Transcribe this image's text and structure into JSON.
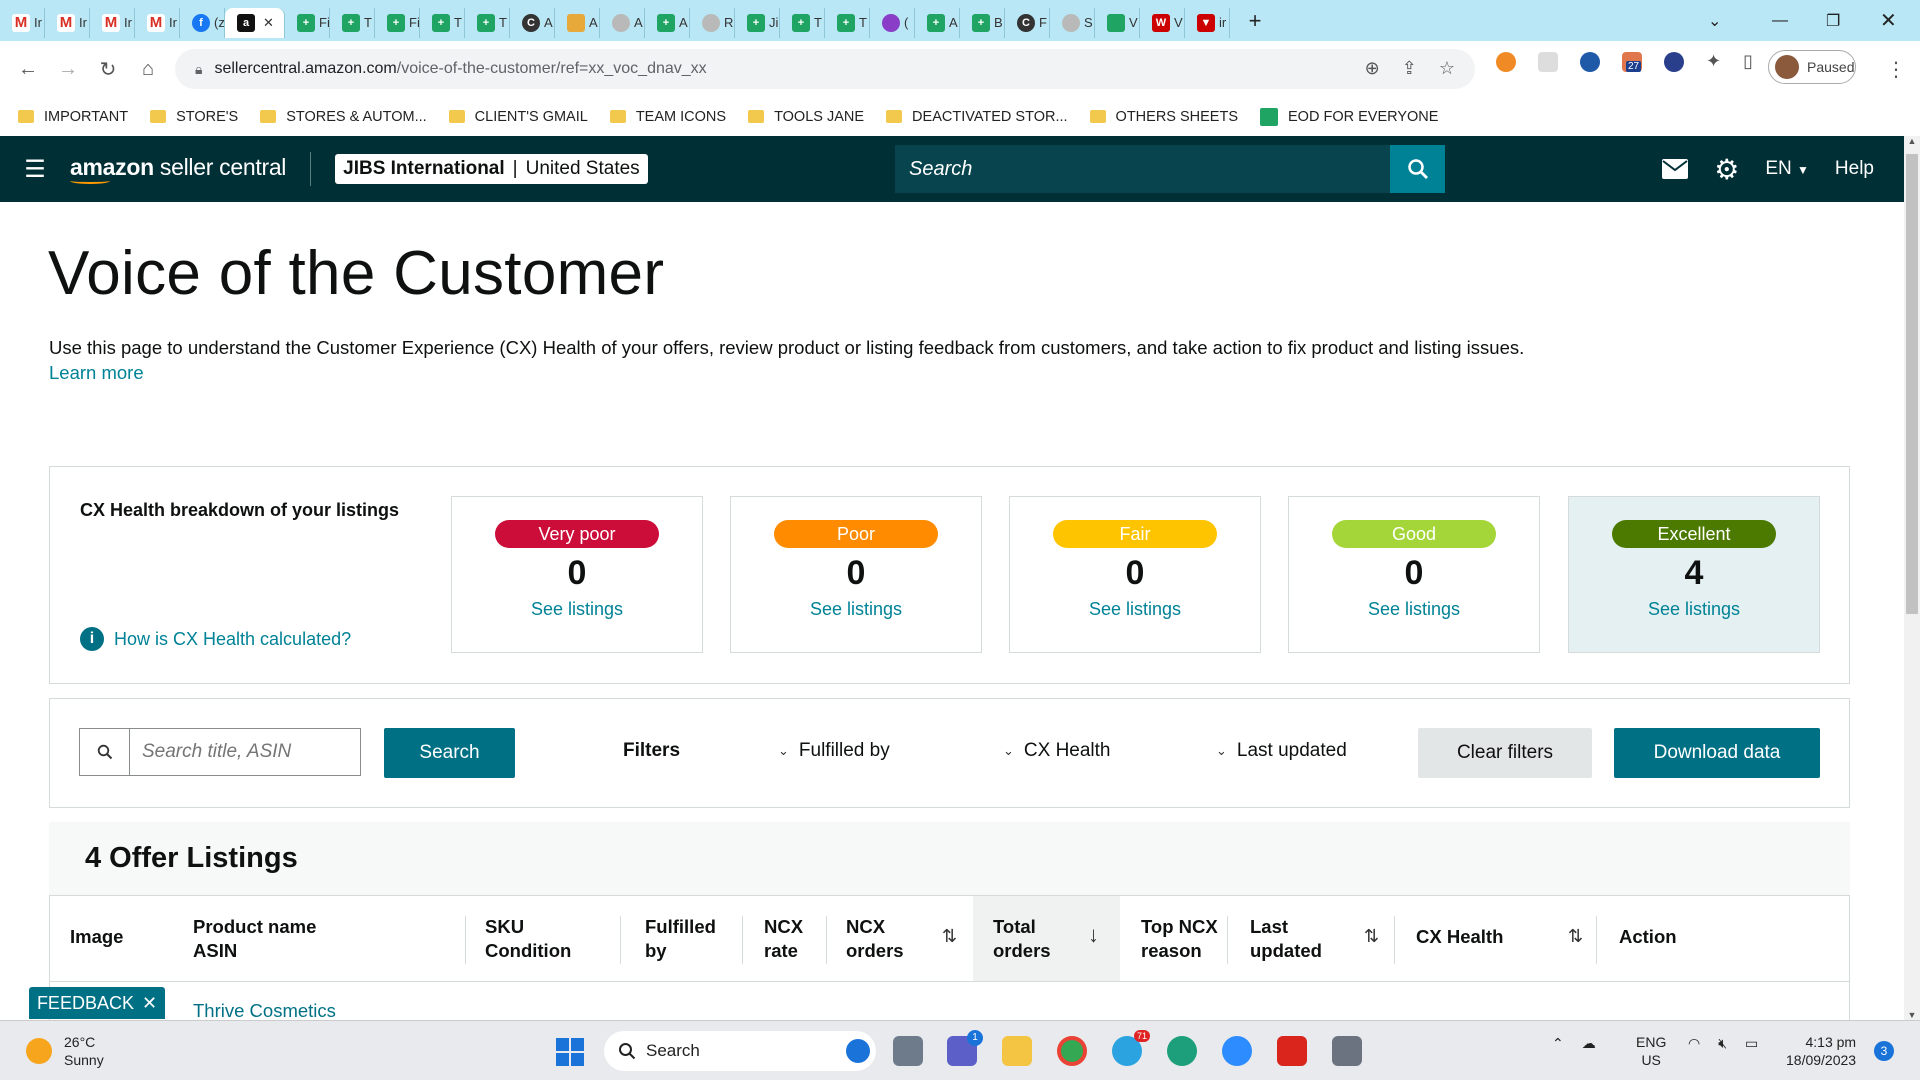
{
  "browser": {
    "tabs": [
      {
        "icon": "gmail-icon",
        "label": "Ir"
      },
      {
        "icon": "gmail-icon",
        "label": "Ir"
      },
      {
        "icon": "gmail-icon",
        "label": "Ir"
      },
      {
        "icon": "gmail-icon",
        "label": "Ir"
      },
      {
        "icon": "facebook-icon",
        "label": "(z"
      },
      {
        "icon": "amazon-icon",
        "label": "",
        "active": true
      },
      {
        "icon": "sheets-icon",
        "label": "Fi"
      },
      {
        "icon": "sheets-icon",
        "label": "T"
      },
      {
        "icon": "sheets-icon",
        "label": "Fi"
      },
      {
        "icon": "sheets-icon",
        "label": "T"
      },
      {
        "icon": "sheets-icon",
        "label": "T"
      },
      {
        "icon": "app-icon",
        "label": "A"
      },
      {
        "icon": "pen-icon",
        "label": "A"
      },
      {
        "icon": "globe-icon",
        "label": "A"
      },
      {
        "icon": "sheets-icon",
        "label": "A"
      },
      {
        "icon": "doc-icon",
        "label": "R"
      },
      {
        "icon": "sheets-icon",
        "label": "Ji"
      },
      {
        "icon": "sheets-icon",
        "label": "T"
      },
      {
        "icon": "sheets-icon",
        "label": "T"
      },
      {
        "icon": "chat-icon",
        "label": "("
      },
      {
        "icon": "sheets-icon",
        "label": "A"
      },
      {
        "icon": "sheets-icon",
        "label": "B"
      },
      {
        "icon": "app-icon",
        "label": "F"
      },
      {
        "icon": "doc-icon",
        "label": "S"
      },
      {
        "icon": "leaf-icon",
        "label": "V"
      },
      {
        "icon": "vw-icon",
        "label": "V"
      },
      {
        "icon": "vee-icon",
        "label": "ir"
      }
    ],
    "url_domain": "sellercentral.amazon.com",
    "url_path": "/voice-of-the-customer/ref=xx_voc_dnav_xx",
    "profile_status": "Paused",
    "extension_badge": "27",
    "bookmarks": [
      {
        "label": "IMPORTANT",
        "type": "folder"
      },
      {
        "label": "STORE'S",
        "type": "folder"
      },
      {
        "label": "STORES & AUTOM...",
        "type": "folder"
      },
      {
        "label": "CLIENT'S GMAIL",
        "type": "folder"
      },
      {
        "label": "TEAM ICONS",
        "type": "folder"
      },
      {
        "label": "TOOLS JANE",
        "type": "folder"
      },
      {
        "label": "DEACTIVATED STOR...",
        "type": "folder"
      },
      {
        "label": "OTHERS SHEETS",
        "type": "folder"
      },
      {
        "label": "EOD FOR EVERYONE",
        "type": "sheet"
      }
    ]
  },
  "header": {
    "logo_bold": "amazon",
    "logo_rest": " seller central",
    "store_name": "JIBS International",
    "store_sep": "|",
    "marketplace": "United States",
    "search_placeholder": "Search",
    "language": "EN",
    "help": "Help"
  },
  "page": {
    "title": "Voice of the Customer",
    "intro": "Use this page to understand the Customer Experience (CX) Health of your offers, review product or listing feedback from customers, and take action to fix product and listing issues.",
    "learn_more": "Learn more"
  },
  "cx": {
    "title": "CX Health breakdown of your listings",
    "how_link": "How is CX Health calculated?",
    "cards": [
      {
        "label": "Very poor",
        "count": "0",
        "link": "See listings",
        "color": "#cc0c39",
        "text_color": "#ffffff"
      },
      {
        "label": "Poor",
        "count": "0",
        "link": "See listings",
        "color": "#ff8c00",
        "text_color": "#ffffff"
      },
      {
        "label": "Fair",
        "count": "0",
        "link": "See listings",
        "color": "#ffc400",
        "text_color": "#ffffff"
      },
      {
        "label": "Good",
        "count": "0",
        "link": "See listings",
        "color": "#a4d63a",
        "text_color": "#ffffff"
      },
      {
        "label": "Excellent",
        "count": "4",
        "link": "See listings",
        "color": "#4c7a00",
        "text_color": "#ffffff",
        "selected": true
      }
    ]
  },
  "filters": {
    "search_placeholder": "Search title, ASIN",
    "search_button": "Search",
    "filters_label": "Filters",
    "fulfilled_by": "Fulfilled by",
    "cx_health": "CX Health",
    "last_updated": "Last updated",
    "clear": "Clear filters",
    "download": "Download data"
  },
  "listings": {
    "heading": "4 Offer Listings",
    "columns": [
      {
        "l1": "Image",
        "l2": ""
      },
      {
        "l1": "Product name",
        "l2": "ASIN"
      },
      {
        "l1": "SKU",
        "l2": "Condition"
      },
      {
        "l1": "Fulfilled",
        "l2": "by"
      },
      {
        "l1": "NCX",
        "l2": "rate"
      },
      {
        "l1": "NCX",
        "l2": "orders"
      },
      {
        "l1": "Total",
        "l2": "orders"
      },
      {
        "l1": "Top NCX",
        "l2": "reason"
      },
      {
        "l1": "Last",
        "l2": "updated"
      },
      {
        "l1": "CX Health",
        "l2": ""
      },
      {
        "l1": "Action",
        "l2": ""
      }
    ],
    "first_product": "Thrive Cosmetics"
  },
  "feedback": {
    "label": "FEEDBACK",
    "close": "✕"
  },
  "taskbar": {
    "temperature": "26°C",
    "weather": "Sunny",
    "search_label": "Search",
    "teams_badge": "1",
    "telegram_badge": "71",
    "lang1": "ENG",
    "lang2": "US",
    "time": "4:13 pm",
    "date": "18/09/2023",
    "notifications": "3"
  }
}
